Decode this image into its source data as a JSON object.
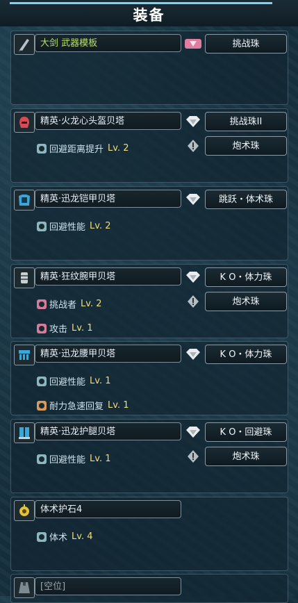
{
  "header": {
    "title": "装备"
  },
  "slots": [
    {
      "name": "大剑 武器模板",
      "icon": "great-sword-icon",
      "jewels": [
        {
          "label": "挑战珠",
          "slot_icon": "pink-gem-slot-icon"
        }
      ],
      "skills": []
    },
    {
      "name": "精英·火龙心头盔贝塔",
      "icon": "helmet-icon",
      "jewels": [
        {
          "label": "挑战珠II",
          "slot_icon": "white-gem-slot-icon"
        },
        {
          "label": "炮术珠",
          "slot_icon": "white-gem-slot-icon"
        }
      ],
      "skills": [
        {
          "name": "回避距离提升",
          "level": "Lv. 2",
          "color": "teal"
        }
      ]
    },
    {
      "name": "精英·迅龙铠甲贝塔",
      "icon": "chest-armor-icon",
      "jewels": [
        {
          "label": "跳跃・体术珠",
          "slot_icon": "white-gem-slot-icon"
        }
      ],
      "skills": [
        {
          "name": "回避性能",
          "level": "Lv. 2",
          "color": "teal"
        }
      ]
    },
    {
      "name": "精英·狂纹腕甲贝塔",
      "icon": "arm-armor-icon",
      "jewels": [
        {
          "label": "K O・体力珠",
          "slot_icon": "white-gem-slot-icon"
        },
        {
          "label": "炮术珠",
          "slot_icon": "white-gem-slot-icon"
        }
      ],
      "skills": [
        {
          "name": "挑战者",
          "level": "Lv. 2",
          "color": "pink"
        },
        {
          "name": "攻击",
          "level": "Lv. 1",
          "color": "pink"
        }
      ]
    },
    {
      "name": "精英·迅龙腰甲贝塔",
      "icon": "waist-armor-icon",
      "jewels": [
        {
          "label": "K O・体力珠",
          "slot_icon": "white-gem-slot-icon"
        }
      ],
      "skills": [
        {
          "name": "回避性能",
          "level": "Lv. 1",
          "color": "teal"
        },
        {
          "name": "耐力急速回复",
          "level": "Lv. 1",
          "color": "orange"
        }
      ]
    },
    {
      "name": "精英·迅龙护腿贝塔",
      "icon": "leg-armor-icon",
      "jewels": [
        {
          "label": "K O・回避珠",
          "slot_icon": "white-gem-slot-icon"
        },
        {
          "label": "炮术珠",
          "slot_icon": "white-gem-slot-icon"
        }
      ],
      "skills": [
        {
          "name": "回避性能",
          "level": "Lv. 1",
          "color": "teal"
        }
      ]
    },
    {
      "name": "体术护石4",
      "icon": "charm-icon",
      "jewels": [],
      "skills": [
        {
          "name": "体术",
          "level": "Lv. 4",
          "color": "teal"
        }
      ]
    },
    {
      "name": "[空位]",
      "icon": "mantle-icon",
      "jewels": [],
      "skills": []
    }
  ]
}
